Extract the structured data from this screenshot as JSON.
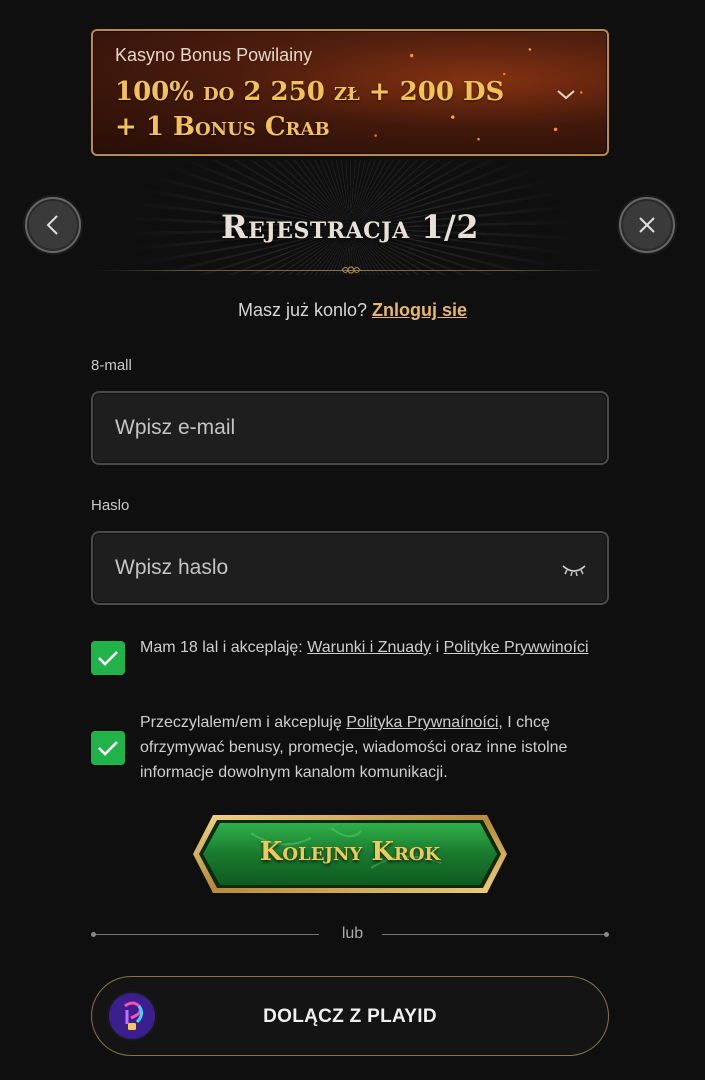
{
  "bonus": {
    "subtitle": "Kasyno Bonus Powilainy",
    "title": "100% do 2 250 zł + 200 DS + 1 Bonus Crab"
  },
  "heading": {
    "title": "Rejestracja 1/2"
  },
  "login_prompt": {
    "text": "Masz już konlo?",
    "link": "Znloguj sie"
  },
  "form": {
    "email_label": "8-mall",
    "email_placeholder": "Wpisz e-mail",
    "password_label": "Haslo",
    "password_placeholder": "Wpisz haslo"
  },
  "consents": [
    {
      "checked": true,
      "prefix": "Mam 18 lal i akceplaję:",
      "link1": "Warunki i Znuady",
      "middle": "i",
      "link2": "Polityke Prywwinoíci",
      "suffix": ""
    },
    {
      "checked": true,
      "prefix": "Przeczylalem/em i akcepluję",
      "link1": "Polityka Prywnaínoíci",
      "suffix": ", I chcę ofrzymywać benusy, promecje, wiadomości oraz inne istolne informacje dowolnym kanalom komunikacji."
    }
  ],
  "next_button": {
    "label": "Kolejny Krok"
  },
  "divider": {
    "label": "lub"
  },
  "playid": {
    "label": "DOLĄCZ Z PLAYID"
  },
  "icons": {
    "back": "chevron-left-icon",
    "close": "close-icon",
    "expand": "chevron-down-icon",
    "eye": "eye-closed-icon",
    "check": "check-icon"
  },
  "colors": {
    "accent_gold": "#e8b86a",
    "check_green": "#21b34a",
    "button_green": "#1f8a35",
    "background": "#0f0f0f"
  }
}
